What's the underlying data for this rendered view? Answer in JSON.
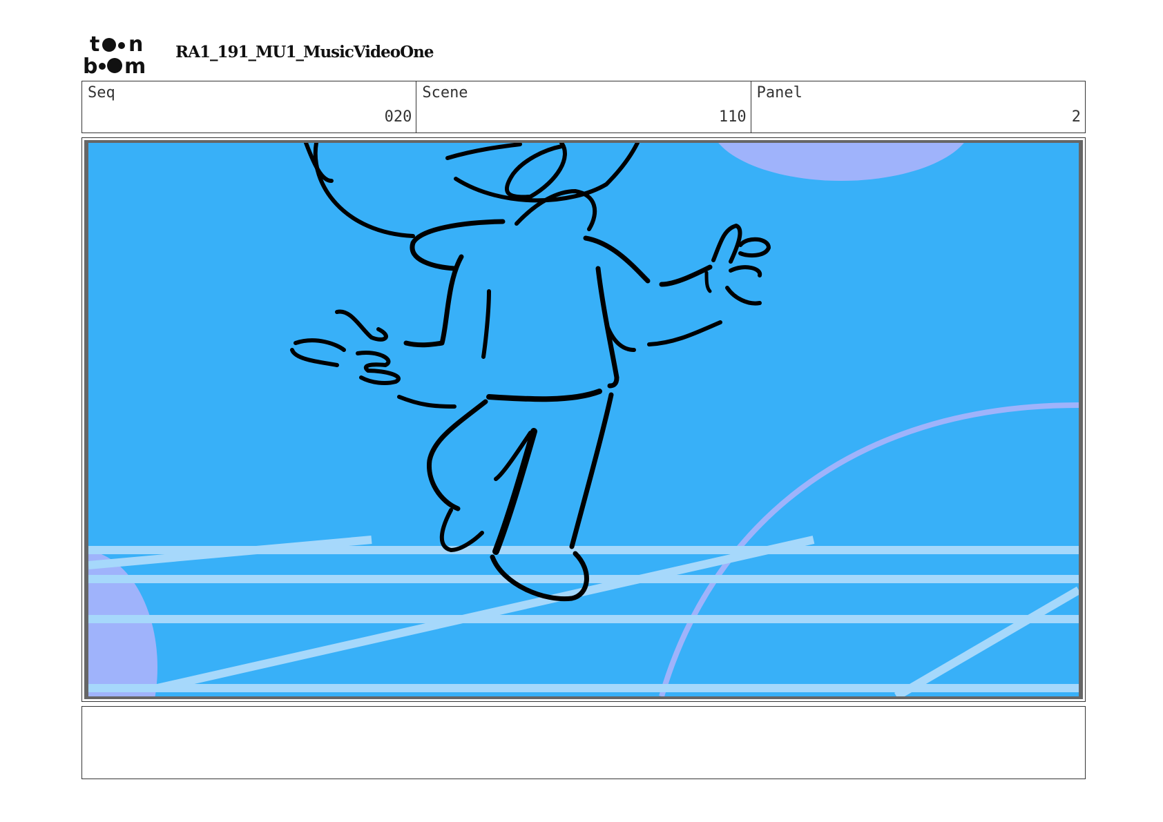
{
  "header": {
    "logo_text": "toon boom",
    "project_title": "RA1_191_MU1_MusicVideoOne"
  },
  "info": {
    "seq_label": "Seq",
    "seq_value": "020",
    "scene_label": "Scene",
    "scene_value": "110",
    "panel_label": "Panel",
    "panel_value": "2"
  },
  "notes": {
    "text": ""
  },
  "colors": {
    "sky": "#38b0f8",
    "floor_lines": "#a6d8fb",
    "bubbles": "#9fb3fb",
    "ink": "#000000"
  }
}
